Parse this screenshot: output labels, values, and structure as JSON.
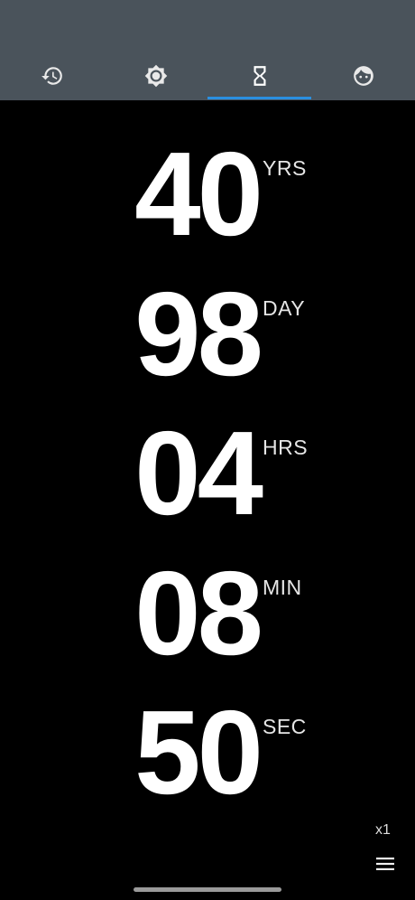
{
  "tabs": [
    {
      "icon": "history-icon",
      "selected": false
    },
    {
      "icon": "brightness-icon",
      "selected": false
    },
    {
      "icon": "hourglass-icon",
      "selected": true
    },
    {
      "icon": "face-icon",
      "selected": false
    }
  ],
  "countdown": [
    {
      "value": "40",
      "unit": "YRS"
    },
    {
      "value": "98",
      "unit": "DAY"
    },
    {
      "value": "04",
      "unit": "HRS"
    },
    {
      "value": "08",
      "unit": "MIN"
    },
    {
      "value": "50",
      "unit": "SEC"
    }
  ],
  "speed_label": "x1",
  "colors": {
    "top_bar": "#4a535b",
    "accent": "#2a8fe0",
    "background": "#000000",
    "text": "#ffffff"
  }
}
